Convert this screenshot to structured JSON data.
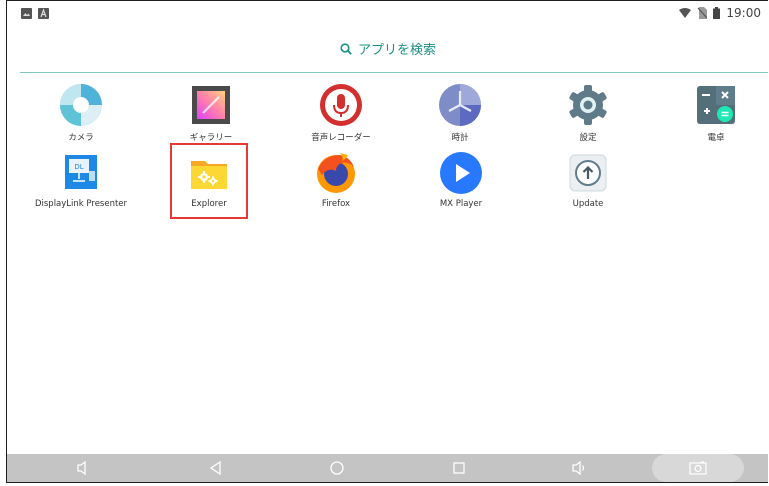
{
  "status_bar": {
    "time": "19:00",
    "left_icons": [
      "image-notification-icon",
      "a-notification-icon"
    ],
    "right_icons": [
      "wifi-icon",
      "no-sim-icon",
      "battery-icon"
    ]
  },
  "search": {
    "label": "アプリを検索",
    "icon": "search-icon",
    "color": "#1b8f83"
  },
  "apps": [
    {
      "label": "カメラ",
      "icon": "camera-icon"
    },
    {
      "label": "ギャラリー",
      "icon": "gallery-icon"
    },
    {
      "label": "音声レコーダー",
      "icon": "voice-recorder-icon"
    },
    {
      "label": "時計",
      "icon": "clock-icon"
    },
    {
      "label": "設定",
      "icon": "settings-icon"
    },
    {
      "label": "電卓",
      "icon": "calculator-icon"
    },
    {
      "label": "DisplayLink Presenter",
      "icon": "displaylink-icon"
    },
    {
      "label": "Explorer",
      "icon": "explorer-icon"
    },
    {
      "label": "Firefox",
      "icon": "firefox-icon"
    },
    {
      "label": "MX Player",
      "icon": "mx-player-icon"
    },
    {
      "label": "Update",
      "icon": "update-icon"
    }
  ],
  "highlighted_app": "Explorer",
  "nav_bar": {
    "buttons": [
      "volume-down-icon",
      "back-icon",
      "home-icon",
      "recents-icon",
      "volume-up-icon",
      "screenshot-icon"
    ]
  }
}
